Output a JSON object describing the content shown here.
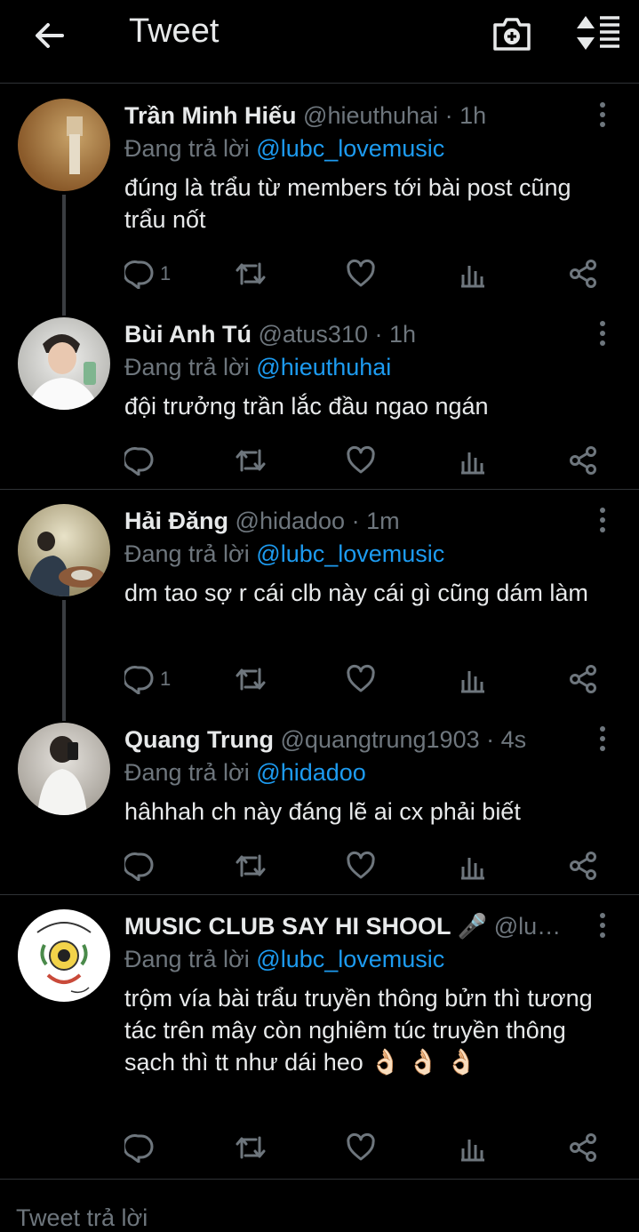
{
  "header": {
    "title": "Tweet"
  },
  "tweets": [
    {
      "name": "Trần Minh Hiếu",
      "handle": "@hieuthuhai",
      "time": "1h",
      "reply_prefix": "Đang trả lời",
      "reply_to": "@lubc_lovemusic",
      "text": "đúng là trẩu từ members tới bài post cũng trẩu nốt",
      "reply_count": "1"
    },
    {
      "name": "Bùi Anh Tú",
      "handle": "@atus310",
      "time": "1h",
      "reply_prefix": "Đang trả lời",
      "reply_to": "@hieuthuhai",
      "text": "đội trưởng trần lắc đầu ngao ngán",
      "reply_count": ""
    },
    {
      "name": "Hải Đăng",
      "handle": "@hidadoo",
      "time": "1m",
      "reply_prefix": "Đang trả lời",
      "reply_to": "@lubc_lovemusic",
      "text": "dm tao sợ r cái clb này cái gì cũng dám làm",
      "reply_count": "1"
    },
    {
      "name": "Quang Trung",
      "handle": "@quangtrung1903",
      "time": "4s",
      "reply_prefix": "Đang trả lời",
      "reply_to": "@hidadoo",
      "text": "hâhhah ch này đáng lẽ ai cx phải biết",
      "reply_count": ""
    },
    {
      "name": "MUSIC CLUB SAY HI SHOOL 🎤",
      "handle": "@lu…",
      "time": "",
      "reply_prefix": "Đang trả lời",
      "reply_to": "@lubc_lovemusic",
      "text": "trộm vía bài trẩu truyền thông bửn thì tương tác trên mây còn nghiêm túc truyền thông sạch thì tt như dái heo",
      "emoji_text": "👌🏻 👌🏻 👌🏻",
      "reply_count": ""
    }
  ],
  "reply_bar": {
    "placeholder": "Tweet trả lời"
  },
  "icons": [
    "back-arrow-icon",
    "camera-plus-icon",
    "sort-icon",
    "more-vertical-icon",
    "reply-icon",
    "retweet-icon",
    "like-icon",
    "analytics-icon",
    "share-icon"
  ],
  "colors": {
    "background": "#000000",
    "text": "#e7e9ea",
    "muted": "#6e767d",
    "link": "#1d9bf0",
    "divider": "#2f3336"
  }
}
